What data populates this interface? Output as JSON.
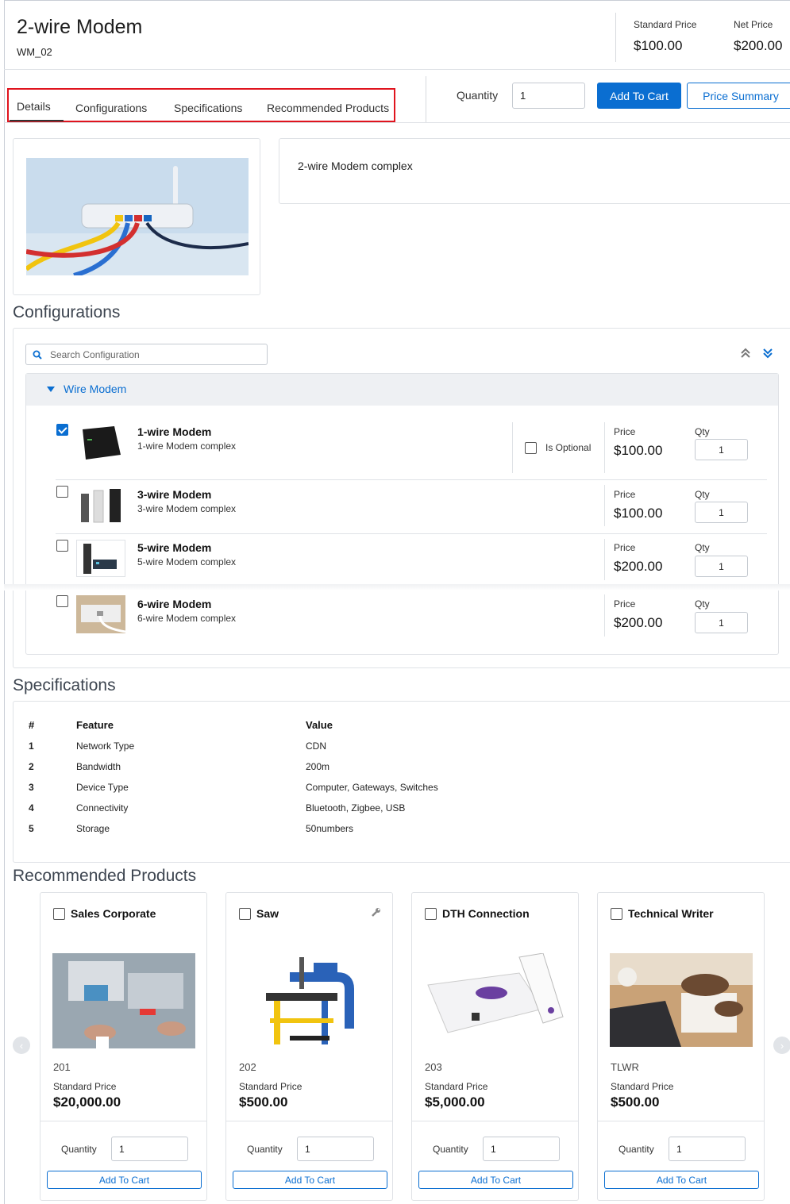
{
  "product": {
    "title": "2-wire Modem",
    "sku": "WM_02",
    "description": "2-wire Modem complex"
  },
  "pricing": {
    "standard_label": "Standard Price",
    "standard_value": "$100.00",
    "net_label": "Net Price",
    "net_value": "$200.00"
  },
  "tabs": [
    "Details",
    "Configurations",
    "Specifications",
    "Recommended Products"
  ],
  "toolbar": {
    "quantity_label": "Quantity",
    "quantity_value": "1",
    "add_to_cart": "Add To Cart",
    "price_summary": "Price Summary"
  },
  "configurations": {
    "section_title": "Configurations",
    "search_placeholder": "Search Configuration",
    "group_name": "Wire Modem",
    "price_label": "Price",
    "qty_label": "Qty",
    "optional_label": "Is Optional",
    "items": [
      {
        "name": "1-wire Modem",
        "desc": "1-wire Modem complex",
        "price": "$100.00",
        "qty": "1",
        "checked": true
      },
      {
        "name": "3-wire Modem",
        "desc": "3-wire Modem complex",
        "price": "$100.00",
        "qty": "1",
        "checked": false
      },
      {
        "name": "5-wire Modem",
        "desc": "5-wire Modem complex",
        "price": "$200.00",
        "qty": "1",
        "checked": false
      },
      {
        "name": "6-wire Modem",
        "desc": "6-wire Modem complex",
        "price": "$200.00",
        "qty": "1",
        "checked": false
      }
    ]
  },
  "specifications": {
    "section_title": "Specifications",
    "headers": [
      "#",
      "Feature",
      "Value"
    ],
    "rows": [
      [
        "1",
        "Network Type",
        "CDN"
      ],
      [
        "2",
        "Bandwidth",
        "200m"
      ],
      [
        "3",
        "Device Type",
        "Computer, Gateways, Switches"
      ],
      [
        "4",
        "Connectivity",
        "Bluetooth, Zigbee, USB"
      ],
      [
        "5",
        "Storage",
        "50numbers"
      ]
    ]
  },
  "recommended": {
    "section_title": "Recommended Products",
    "price_label": "Standard Price",
    "quantity_label": "Quantity",
    "add_label": "Add To Cart",
    "items": [
      {
        "name": "Sales Corporate",
        "code": "201",
        "price": "$20,000.00",
        "qty": "1"
      },
      {
        "name": "Saw",
        "code": "202",
        "price": "$500.00",
        "qty": "1"
      },
      {
        "name": "DTH Connection",
        "code": "203",
        "price": "$5,000.00",
        "qty": "1"
      },
      {
        "name": "Technical Writer",
        "code": "TLWR",
        "price": "$500.00",
        "qty": "1"
      }
    ]
  },
  "colors": {
    "accent": "#0a6ed1",
    "highlight_border": "#e0141e"
  }
}
